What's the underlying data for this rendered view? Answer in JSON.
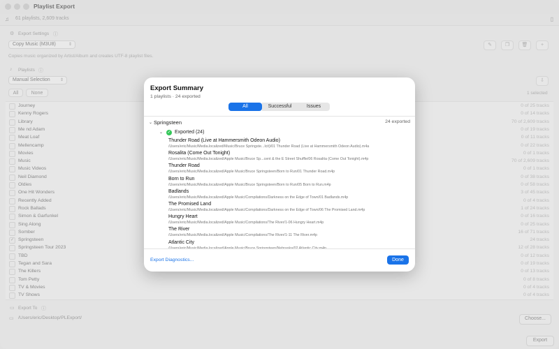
{
  "window": {
    "title": "Playlist Export",
    "summary": "61 playlists, 2,609 tracks"
  },
  "export_settings": {
    "label": "Export Settings",
    "mode": "Copy Music (M3U8)",
    "description": "Copies music organized by Artist/Album and creates UTF-8 playlist files."
  },
  "playlists": {
    "label": "Playlists",
    "selection_mode": "Manual Selection",
    "all_label": "All",
    "none_label": "None",
    "selected_count": "1 selected",
    "items": [
      {
        "name": "Journey",
        "count": "0 of 25 tracks",
        "checked": false
      },
      {
        "name": "Kenny Rogers",
        "count": "0 of 14 tracks",
        "checked": false
      },
      {
        "name": "Library",
        "count": "70 of 2,609 tracks",
        "checked": false
      },
      {
        "name": "Me nd Adam",
        "count": "0 of 19 tracks",
        "checked": false
      },
      {
        "name": "Meat Loaf",
        "count": "0 of 11 tracks",
        "checked": false
      },
      {
        "name": "Mellencamp",
        "count": "0 of 22 tracks",
        "checked": false
      },
      {
        "name": "Movies",
        "count": "0 of 1 tracks",
        "checked": false
      },
      {
        "name": "Music",
        "count": "70 of 2,609 tracks",
        "checked": false
      },
      {
        "name": "Music Videos",
        "count": "0 of 1 tracks",
        "checked": false
      },
      {
        "name": "Neil Diamond",
        "count": "0 of 38 tracks",
        "checked": false
      },
      {
        "name": "Oldies",
        "count": "0 of 58 tracks",
        "checked": false
      },
      {
        "name": "One Hit Wonders",
        "count": "3 of 45 tracks",
        "checked": false
      },
      {
        "name": "Recently Added",
        "count": "0 of 4 tracks",
        "checked": false
      },
      {
        "name": "Rock Ballads",
        "count": "1 of 24 tracks",
        "checked": false
      },
      {
        "name": "Simon & Garfunkel",
        "count": "0 of 16 tracks",
        "checked": false
      },
      {
        "name": "Sing Along",
        "count": "0 of 25 tracks",
        "checked": false
      },
      {
        "name": "Somber",
        "count": "16 of 71 tracks",
        "checked": false
      },
      {
        "name": "Springsteen",
        "count": "24 tracks",
        "checked": true
      },
      {
        "name": "Springsteen Tour 2023",
        "count": "12 of 28 tracks",
        "checked": false
      },
      {
        "name": "TBD",
        "count": "0 of 12 tracks",
        "checked": false
      },
      {
        "name": "Tegan and Sara",
        "count": "0 of 19 tracks",
        "checked": false
      },
      {
        "name": "The Killers",
        "count": "0 of 13 tracks",
        "checked": false
      },
      {
        "name": "Tom Petty",
        "count": "0 of 8 tracks",
        "checked": false
      },
      {
        "name": "TV & Movies",
        "count": "0 of 4 tracks",
        "checked": false
      },
      {
        "name": "TV Shows",
        "count": "0 of 4 tracks",
        "checked": false
      }
    ]
  },
  "export_to": {
    "label": "Export To",
    "path": "/Users/eric/Desktop/PLExport/",
    "choose_label": "Choose..."
  },
  "export_button": "Export",
  "modal": {
    "title": "Export Summary",
    "summary": "1 playlists · 24 exported",
    "tabs": [
      "All",
      "Successful",
      "Issues"
    ],
    "active_tab": "All",
    "group": {
      "name": "Springsteen",
      "count": "24 exported"
    },
    "exported_header": "Exported (24)",
    "tracks": [
      {
        "name": "Thunder Road (Live at Hammersmith Odeon Audio)",
        "path": "/Users/eric/Music/Media.localized/Music/Bruce Springste...lcit)/01 Thunder Road (Live at Hammersmith Odeon Audio).m4a"
      },
      {
        "name": "Rosalita (Come Out Tonight)",
        "path": "/Users/eric/Music/Media.localized/Apple Music/Bruce Sp...cent & the E Street Shuffle/06 Rosalita (Come Out Tonight).m4p"
      },
      {
        "name": "Thunder Road",
        "path": "/Users/eric/Music/Media.localized/Apple Music/Bruce Springsteen/Born to Run/01 Thunder Road.m4p"
      },
      {
        "name": "Born to Run",
        "path": "/Users/eric/Music/Media.localized/Apple Music/Bruce Springsteen/Born to Run/05 Born to Run.m4p"
      },
      {
        "name": "Badlands",
        "path": "/Users/eric/Music/Media.localized/Apple Music/Compilations/Darkness on the Edge of Town/01 Badlands.m4p"
      },
      {
        "name": "The Promised Land",
        "path": "/Users/eric/Music/Media.localized/Apple Music/Compilations/Darkness on the Edge of Town/06 The Promised Land.m4p"
      },
      {
        "name": "Hungry Heart",
        "path": "/Users/eric/Music/Media.localized/Apple Music/Compilations/The River/1-06 Hungry Heart.m4p"
      },
      {
        "name": "The River",
        "path": "/Users/eric/Music/Media.localized/Apple Music/Compilations/The River/1-11 The River.m4p"
      },
      {
        "name": "Atlantic City",
        "path": "/Users/eric/Music/Media.localized/Apple Music/Bruce Springsteen/Nebraska/02 Atlantic City.m4p"
      }
    ],
    "diagnostics_label": "Export Diagnostics...",
    "done_label": "Done"
  }
}
